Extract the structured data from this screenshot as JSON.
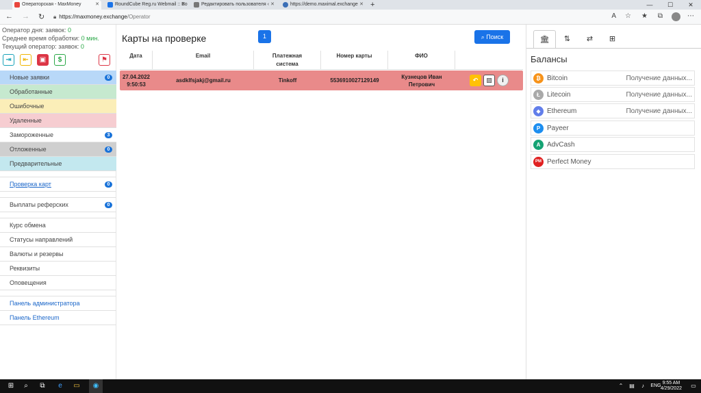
{
  "browser": {
    "tabs": [
      {
        "title": "Операторская - MaxMoney",
        "color": "#e8453c",
        "active": true
      },
      {
        "title": "RoundCube Reg.ru Webmail :: Bo",
        "color": "#1a73e8",
        "active": false
      },
      {
        "title": "Редактировать пользователя ‹",
        "color": "#777777",
        "active": false
      },
      {
        "title": "https://demo.maximal.exchange",
        "color": "#3b6fb6",
        "active": false
      }
    ],
    "url_host": "https://maxmoney.exchange",
    "url_path": "/Operator"
  },
  "sidebar": {
    "stats": {
      "operator_day_label": "Оператор дня:",
      "operator_day_orders_label": "заявок:",
      "operator_day_orders": "0",
      "avg_time_label": "Среднее время обработки:",
      "avg_time": "0 мин.",
      "current_operator_label": "Текущий оператор:",
      "current_orders_label": "заявок:",
      "current_orders": "0"
    },
    "menu": [
      {
        "label": "Новые заявки",
        "badge": "0",
        "bg": "#b8d8f8"
      },
      {
        "label": "Обработанные",
        "badge": "",
        "bg": "#c6e9cf"
      },
      {
        "label": "Ошибочные",
        "badge": "",
        "bg": "#fbeeb8"
      },
      {
        "label": "Удаленные",
        "badge": "",
        "bg": "#f6cdd1"
      },
      {
        "label": "Замороженные",
        "badge": "3",
        "bg": "#ffffff"
      },
      {
        "label": "Отложенные",
        "badge": "0",
        "bg": "#cfcfcf"
      },
      {
        "label": "Предварительные",
        "badge": "",
        "bg": "#c3e8ef"
      }
    ],
    "card_check": {
      "label": "Проверка карт",
      "badge": "0"
    },
    "referral": {
      "label": "Выплаты реферских",
      "badge": "0"
    },
    "admin_items": [
      "Курс обмена",
      "Статусы направлений",
      "Валюты и резервы",
      "Реквизиты",
      "Оповещения"
    ],
    "links": [
      "Панель администратора",
      "Панель Ethereum"
    ]
  },
  "main": {
    "title": "Карты на проверке",
    "count": "1",
    "search_label": "Поиск",
    "columns": [
      "Дата",
      "Email",
      "Платежная система",
      "Номер карты",
      "ФИО",
      ""
    ],
    "rows": [
      {
        "date": "27.04.2022",
        "time": "9:50:53",
        "email": "asdklfsjakj@gmail.ru",
        "system": "Tinkoff",
        "card": "5536910027129149",
        "name_line1": "Кузнецов Иван",
        "name_line2": "Петрович"
      }
    ]
  },
  "balances": {
    "title": "Балансы",
    "items": [
      {
        "name": "Bitcoin",
        "status": "Получение данных...",
        "color": "#f7931a",
        "icon": "bitcoin-icon"
      },
      {
        "name": "Litecoin",
        "status": "Получение данных...",
        "color": "#a9a9a9",
        "icon": "litecoin-icon"
      },
      {
        "name": "Ethereum",
        "status": "Получение данных...",
        "color": "#627eea",
        "icon": "ethereum-icon"
      },
      {
        "name": "Payeer",
        "status": "",
        "color": "#1c8ef0",
        "icon": "payeer-icon"
      },
      {
        "name": "AdvCash",
        "status": "",
        "color": "#15a374",
        "icon": "advcash-icon"
      },
      {
        "name": "Perfect Money",
        "status": "",
        "color": "#e02020",
        "icon": "perfectmoney-icon"
      }
    ]
  },
  "taskbar": {
    "lang": "ENG",
    "time": "9:55 AM",
    "date": "4/29/2022"
  }
}
